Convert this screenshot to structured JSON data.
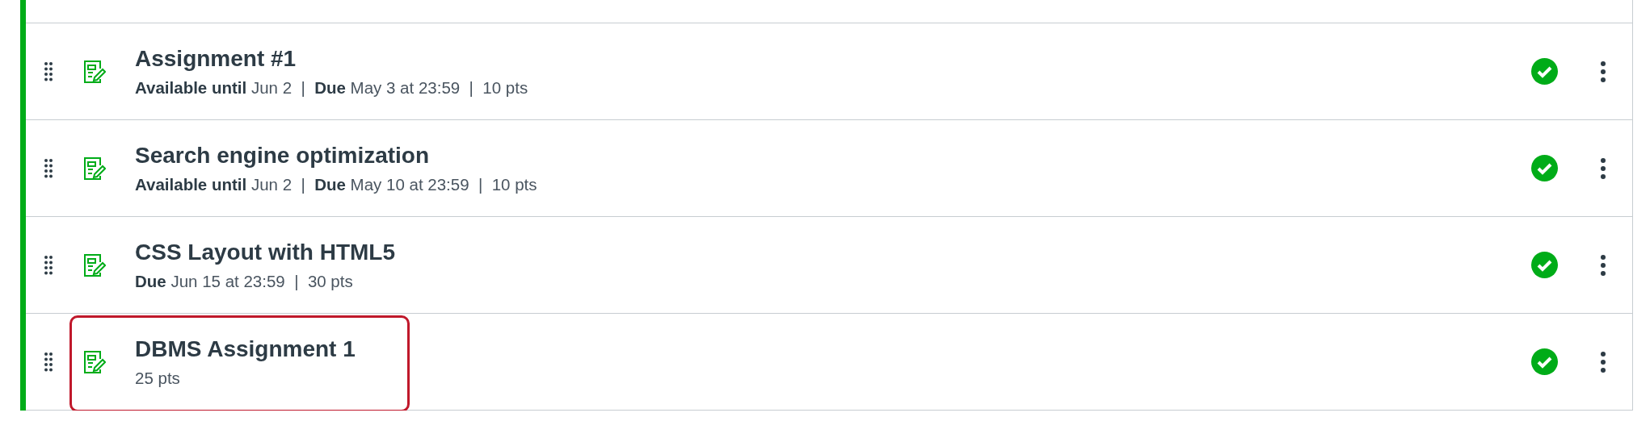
{
  "items": [
    {
      "title": "Assignment #1",
      "meta": "**Available until** Jun 2  |  **Due** May 3 at 23:59  |  10 pts",
      "published": true,
      "highlighted": false
    },
    {
      "title": "Search engine optimization",
      "meta": "**Available until** Jun 2  |  **Due** May 10 at 23:59  |  10 pts",
      "published": true,
      "highlighted": false
    },
    {
      "title": "CSS Layout with HTML5",
      "meta": "**Due** Jun 15 at 23:59  |  30 pts",
      "published": true,
      "highlighted": false
    },
    {
      "title": "DBMS Assignment 1",
      "meta": "25 pts",
      "published": true,
      "highlighted": true
    }
  ]
}
